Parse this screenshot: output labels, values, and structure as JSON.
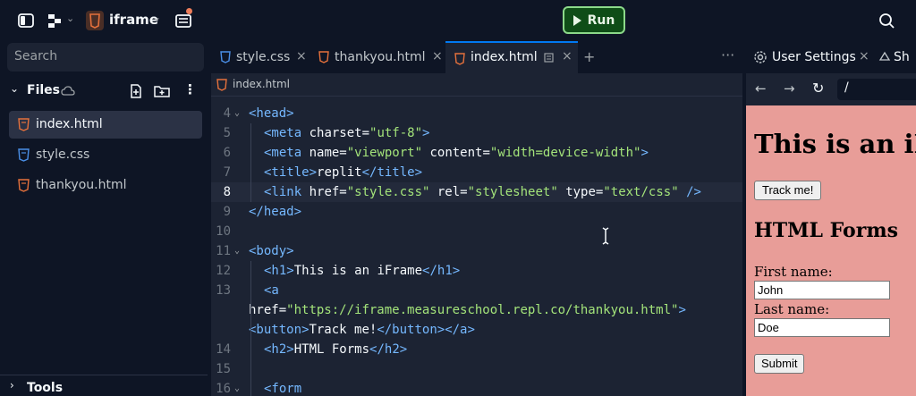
{
  "app": {
    "repl_name": "iframe",
    "run_label": "Run"
  },
  "sidebar": {
    "search_placeholder": "Search",
    "files_title": "Files",
    "files": [
      {
        "name": "index.html",
        "type": "html",
        "active": true
      },
      {
        "name": "style.css",
        "type": "css",
        "active": false
      },
      {
        "name": "thankyou.html",
        "type": "html",
        "active": false
      }
    ],
    "tools_title": "Tools"
  },
  "editor": {
    "tabs": [
      {
        "label": "style.css",
        "type": "css",
        "active": false
      },
      {
        "label": "thankyou.html",
        "type": "html",
        "active": false
      },
      {
        "label": "index.html",
        "type": "html",
        "active": true
      }
    ],
    "breadcrumb": "index.html",
    "current_line": "8",
    "lines": [
      {
        "num": "4",
        "fold": true,
        "indent": 0,
        "text": "<head>"
      },
      {
        "num": "5",
        "fold": false,
        "indent": 1,
        "text": "<meta charset=\"utf-8\">"
      },
      {
        "num": "6",
        "fold": false,
        "indent": 1,
        "text": "<meta name=\"viewport\" content=\"width=device-width\">"
      },
      {
        "num": "7",
        "fold": false,
        "indent": 1,
        "text": "<title>replit</title>"
      },
      {
        "num": "8",
        "fold": false,
        "indent": 1,
        "text": "<link href=\"style.css\" rel=\"stylesheet\" type=\"text/css\" />"
      },
      {
        "num": "9",
        "fold": false,
        "indent": 0,
        "text": "</head>"
      },
      {
        "num": "10",
        "fold": false,
        "indent": 0,
        "text": ""
      },
      {
        "num": "11",
        "fold": true,
        "indent": 0,
        "text": "<body>"
      },
      {
        "num": "12",
        "fold": false,
        "indent": 1,
        "text": "<h1>This is an iFrame</h1>"
      },
      {
        "num": "13",
        "fold": false,
        "indent": 1,
        "text": "<a"
      },
      {
        "num": "",
        "fold": false,
        "indent": 0,
        "text": "href=\"https://iframe.measureschool.repl.co/thankyou.html\">"
      },
      {
        "num": "",
        "fold": false,
        "indent": 0,
        "text": "<button>Track me!</button></a>"
      },
      {
        "num": "14",
        "fold": false,
        "indent": 1,
        "text": "<h2>HTML Forms</h2>"
      },
      {
        "num": "15",
        "fold": false,
        "indent": 0,
        "text": ""
      },
      {
        "num": "16",
        "fold": true,
        "indent": 1,
        "text": "<form"
      }
    ]
  },
  "right_panel": {
    "tabs": [
      {
        "label": "User Settings"
      },
      {
        "label": "Sh"
      }
    ],
    "url": "/",
    "preview": {
      "h1": "This is an iFr",
      "button": "Track me!",
      "h2": "HTML Forms",
      "first_label": "First name:",
      "first_value": "John",
      "last_label": "Last name:",
      "last_value": "Doe",
      "submit": "Submit"
    }
  },
  "colors": {
    "accent": "#0079f2",
    "run_green": "#0f4d17",
    "preview_bg": "#e89d98",
    "html_icon": "#e5713c",
    "css_icon": "#4a8fe7"
  }
}
